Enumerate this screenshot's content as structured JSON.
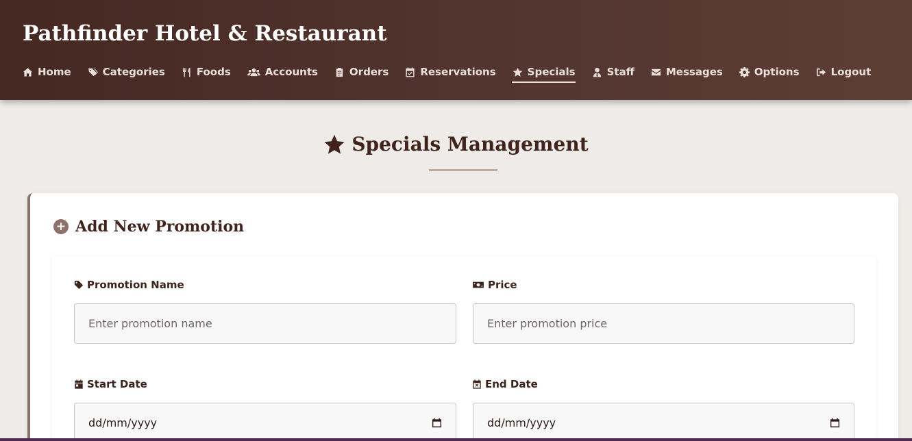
{
  "header": {
    "brand": "Pathfinder Hotel & Restaurant",
    "nav": [
      {
        "label": "Home",
        "icon": "home-icon"
      },
      {
        "label": "Categories",
        "icon": "tags-icon"
      },
      {
        "label": "Foods",
        "icon": "utensils-icon"
      },
      {
        "label": "Accounts",
        "icon": "users-icon"
      },
      {
        "label": "Orders",
        "icon": "clipboard-icon"
      },
      {
        "label": "Reservations",
        "icon": "calendar-check-icon"
      },
      {
        "label": "Specials",
        "icon": "star-icon",
        "active": true
      },
      {
        "label": "Staff",
        "icon": "user-tie-icon"
      },
      {
        "label": "Messages",
        "icon": "envelope-icon"
      },
      {
        "label": "Options",
        "icon": "gear-icon"
      },
      {
        "label": "Logout",
        "icon": "logout-icon"
      }
    ]
  },
  "page": {
    "title": "Specials Management",
    "title_icon": "star-icon"
  },
  "form": {
    "heading": "Add New Promotion",
    "heading_icon": "plus-circle-icon",
    "fields": {
      "name": {
        "label": "Promotion Name",
        "placeholder": "Enter promotion name",
        "icon": "tag-icon"
      },
      "price": {
        "label": "Price",
        "placeholder": "Enter promotion price",
        "icon": "money-bill-icon"
      },
      "start": {
        "label": "Start Date",
        "value": "dd/mm/yyyy",
        "icon": "calendar-icon"
      },
      "end": {
        "label": "End Date",
        "value": "dd/mm/yyyy",
        "icon": "calendar-x-icon"
      }
    }
  },
  "colors": {
    "header_dark": "#452822",
    "header_light": "#5c3e35",
    "accent": "#8c726b",
    "text_dark": "#40231c",
    "background": "#efebe8"
  }
}
